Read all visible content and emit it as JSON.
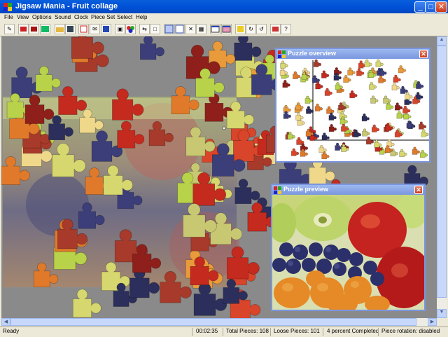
{
  "window": {
    "title": "Jigsaw Mania - Fruit collage"
  },
  "menu": [
    "File",
    "View",
    "Options",
    "Sound",
    "Clock",
    "Piece Set",
    "Select",
    "Help"
  ],
  "toolbar": {
    "buttons": [
      "new-puzzle",
      "pieces",
      "pieces-alt",
      "picture",
      "open",
      "save",
      "calendar",
      "email",
      "info",
      "arrange",
      "colors",
      "sort-edges",
      "outline",
      "grid",
      "grid-alt",
      "remove",
      "scatter",
      "overview",
      "preview",
      "ghost",
      "rotate",
      "rotate-alt",
      "settings",
      "help"
    ]
  },
  "overview": {
    "title": "Puzzle overview"
  },
  "preview": {
    "title": "Puzzle preview",
    "colors": {
      "grape": "#2b2f6a",
      "apple": "#c4231f",
      "melon": "#b9d46a",
      "orange": "#e58a26"
    }
  },
  "status": {
    "ready": "Ready",
    "time": "00:02:35",
    "total": "Total Pieces: 108",
    "loose": "Loose Pieces: 101",
    "percent": "4 percent Completed",
    "rotation": "Piece rotation: disabled"
  }
}
